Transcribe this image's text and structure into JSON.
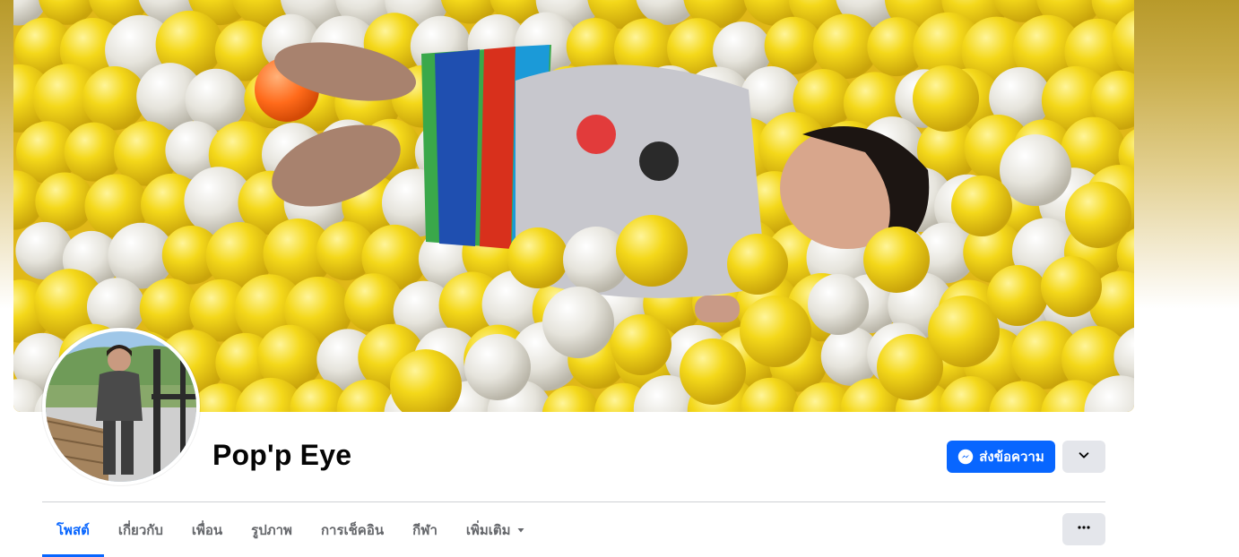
{
  "profile": {
    "name": "Pop'p Eye"
  },
  "actions": {
    "message_label": "ส่งข้อความ",
    "message_icon": "messenger-icon",
    "chevron_icon": "chevron-down-icon",
    "more_icon": "more-horizontal-icon"
  },
  "tabs": [
    {
      "label": "โพสต์",
      "active": true
    },
    {
      "label": "เกี่ยวกับ",
      "active": false
    },
    {
      "label": "เพื่อน",
      "active": false
    },
    {
      "label": "รูปภาพ",
      "active": false
    },
    {
      "label": "การเช็คอิน",
      "active": false
    },
    {
      "label": "กีฬา",
      "active": false
    },
    {
      "label": "เพิ่มเติม",
      "active": false,
      "has_dropdown": true
    }
  ],
  "colors": {
    "accent": "#0866ff",
    "secondary_button": "#e4e6eb",
    "tab_text": "#65676b",
    "name_text": "#050505",
    "cover_gold": "#b89a2a"
  }
}
